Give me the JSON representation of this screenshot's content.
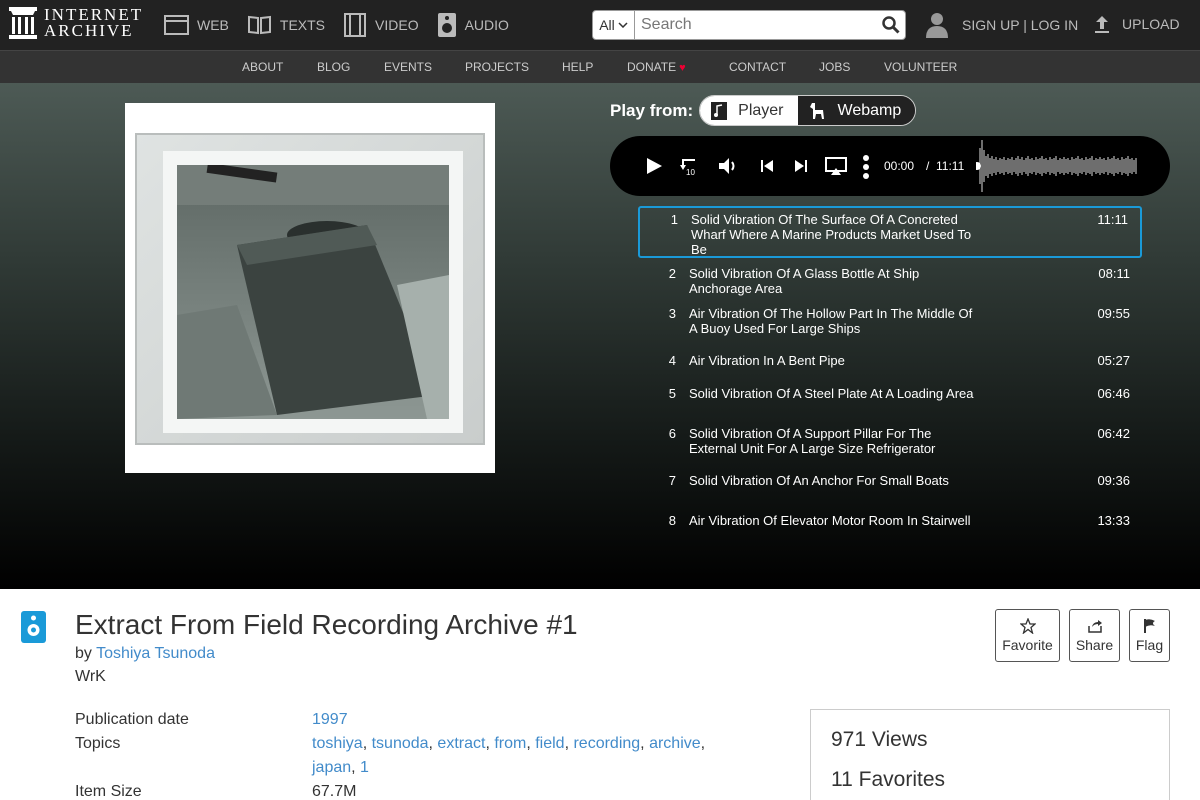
{
  "header": {
    "logo_line1": "INTERNET",
    "logo_line2": "ARCHIVE",
    "media": [
      {
        "label": "WEB",
        "icon": "web-icon"
      },
      {
        "label": "TEXTS",
        "icon": "texts-icon"
      },
      {
        "label": "VIDEO",
        "icon": "video-icon"
      },
      {
        "label": "AUDIO",
        "icon": "audio-icon"
      }
    ],
    "search": {
      "scope": "All",
      "placeholder": "Search"
    },
    "auth": "SIGN UP | LOG IN",
    "upload": "UPLOAD"
  },
  "subnav": [
    "ABOUT",
    "BLOG",
    "EVENTS",
    "PROJECTS",
    "HELP",
    "DONATE",
    "CONTACT",
    "JOBS",
    "VOLUNTEER"
  ],
  "player": {
    "play_from_label": "Play from:",
    "options": [
      "Player",
      "Webamp"
    ],
    "current_time": "00:00",
    "separator": "/",
    "total_time": "11:11"
  },
  "tracks": [
    {
      "num": "1",
      "title": "Solid Vibration Of The Surface Of A Concreted Wharf Where A Marine Products Market Used To Be",
      "duration": "11:11"
    },
    {
      "num": "2",
      "title": "Solid Vibration Of A Glass Bottle At Ship Anchorage Area",
      "duration": "08:11"
    },
    {
      "num": "3",
      "title": "Air Vibration Of The Hollow Part In The Middle Of A Buoy Used For Large Ships",
      "duration": "09:55"
    },
    {
      "num": "4",
      "title": "Air Vibration In A Bent Pipe",
      "duration": "05:27"
    },
    {
      "num": "5",
      "title": "Solid Vibration Of A Steel Plate At A Loading Area",
      "duration": "06:46"
    },
    {
      "num": "6",
      "title": "Solid Vibration Of A Support Pillar For The External Unit For A Large Size Refrigerator",
      "duration": "06:42"
    },
    {
      "num": "7",
      "title": "Solid Vibration Of An Anchor For Small Boats",
      "duration": "09:36"
    },
    {
      "num": "8",
      "title": "Air Vibration Of Elevator Motor Room In Stairwell",
      "duration": "13:33"
    }
  ],
  "item": {
    "title": "Extract From Field Recording Archive #1",
    "by": "by",
    "creator": "Toshiya Tsunoda",
    "publisher": "WrK",
    "actions": [
      "Favorite",
      "Share",
      "Flag"
    ],
    "meta": {
      "pub_label": "Publication date",
      "pub_value": "1997",
      "topics_label": "Topics",
      "topics": [
        "toshiya",
        "tsunoda",
        "extract",
        "from",
        "field",
        "recording",
        "archive",
        "japan",
        "1"
      ],
      "size_label": "Item Size",
      "size_value": "67.7M"
    },
    "stats": {
      "views": "971 Views",
      "favorites": "11 Favorites"
    }
  }
}
